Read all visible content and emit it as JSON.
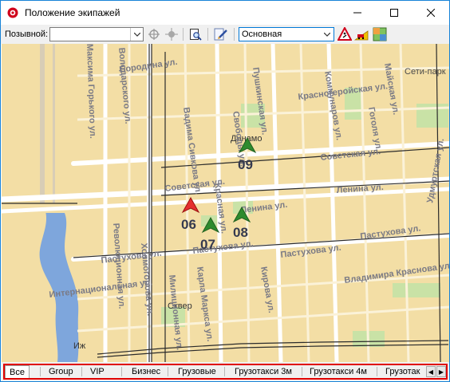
{
  "window": {
    "title": "Положение экипажей",
    "minimize_label": "—",
    "maximize_label": "☐",
    "close_label": "✕"
  },
  "toolbar": {
    "callsign_label": "Позывной:",
    "callsign_value": "",
    "layer_value": "Основная",
    "icons": [
      "locate-icon",
      "crosshair-icon",
      "print-preview-icon",
      "edit-map-icon",
      "roadwork-icon",
      "traffic-icon",
      "map-layers-icon"
    ]
  },
  "map": {
    "streets": [
      "Бородина ул.",
      "Красногеройская ул.",
      "Сети-парк",
      "Динамо",
      "Советская ул.",
      "Ленина ул.",
      "Пастухова ул.",
      "Интернациональная ул.",
      "Сквер",
      "Иж",
      "Свободы ул.",
      "Пушкинская ул.",
      "Коммунаров ул.",
      "Гоголя ул.",
      "Карла Маркса ул.",
      "Милиционная ул.",
      "Удмуртская ул.",
      "Вадима Сивкова ул.",
      "Красная ул.",
      "Володарского ул.",
      "Холмогорова ул.",
      "Максима Горького ул.",
      "Революционная ул.",
      "Кирова ул.",
      "Майская ул.",
      "Владимира Краснова ул."
    ],
    "cars": [
      {
        "number": "09",
        "color": "green"
      },
      {
        "number": "06",
        "color": "red"
      },
      {
        "number": "07",
        "color": "green"
      },
      {
        "number": "08",
        "color": "green"
      }
    ]
  },
  "tabs": {
    "items": [
      {
        "label": "Все",
        "active": true
      },
      {
        "label": "Group",
        "active": false
      },
      {
        "label": "VIP",
        "active": false
      },
      {
        "label": "Бизнес",
        "active": false
      },
      {
        "label": "Грузовые",
        "active": false
      },
      {
        "label": "Грузотакси 3м",
        "active": false
      },
      {
        "label": "Грузотакси 4м",
        "active": false
      },
      {
        "label": "Грузотак",
        "active": false
      }
    ],
    "scroll_left": "◀",
    "scroll_right": "▶"
  }
}
